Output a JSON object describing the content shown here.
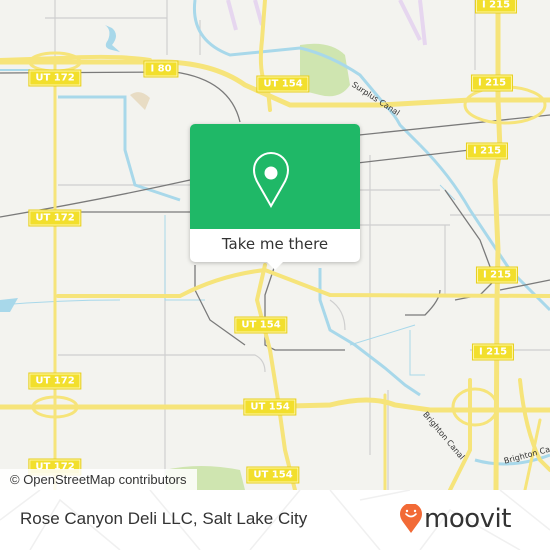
{
  "map": {
    "highway_shields": [
      {
        "id": "ut172-top",
        "label": "UT 172"
      },
      {
        "id": "i80",
        "label": "I 80"
      },
      {
        "id": "ut154-top",
        "label": "UT 154"
      },
      {
        "id": "i215-top",
        "label": "I 215"
      },
      {
        "id": "i215-mid1",
        "label": "I 215"
      },
      {
        "id": "i215-mid2",
        "label": "I 215"
      },
      {
        "id": "i215-mid3",
        "label": "I 215"
      },
      {
        "id": "i215-mid4",
        "label": "I 215"
      },
      {
        "id": "ut172-mid",
        "label": "UT 172"
      },
      {
        "id": "ut154-mid",
        "label": "UT 154"
      },
      {
        "id": "ut172-low",
        "label": "UT 172"
      },
      {
        "id": "ut154-low",
        "label": "UT 154"
      },
      {
        "id": "ut172-bottom",
        "label": "UT 172"
      },
      {
        "id": "ut154-bottom",
        "label": "UT 154"
      }
    ],
    "waterway_labels": [
      {
        "id": "surplus",
        "label": "Surplus Canal"
      },
      {
        "id": "brighton1",
        "label": "Brighton Canal"
      },
      {
        "id": "brighton2",
        "label": "Brighton Canal"
      }
    ],
    "attribution": "© OpenStreetMap contributors",
    "colors": {
      "background": "#f3f3ef",
      "road": "#f6e47a",
      "water": "#a8d8ea",
      "park": "#cfe5b0",
      "rail": "#777777"
    }
  },
  "popup": {
    "icon": "location-pin-icon",
    "button_label": "Take me there",
    "color": "#1fb867"
  },
  "footer": {
    "place_name": "Rose Canyon Deli LLC, Salt Lake City",
    "brand": "moovit",
    "brand_color": "#f26a36"
  }
}
